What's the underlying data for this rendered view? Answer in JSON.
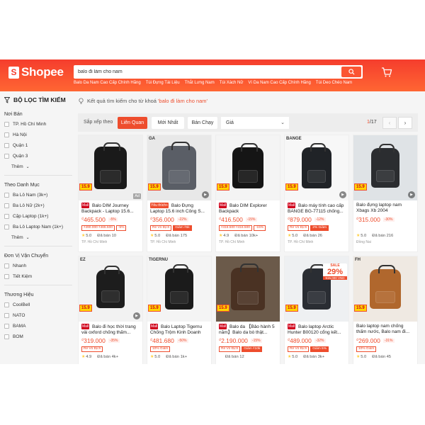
{
  "header": {
    "logo_text": "Shopee",
    "search_value": "balo đi làm cho nam",
    "keywords": [
      "Balo Da Nam Cao Cấp Chính Hãng",
      "Túi Đựng Tài Liệu",
      "Thắt Lưng Nam",
      "Túi Xách Nữ",
      "Ví Da Nam Cao Cấp Chính Hãng",
      "Túi Deo Chéo Nam"
    ]
  },
  "sidebar": {
    "title": "BỘ LỌC TÌM KIẾM",
    "groups": [
      {
        "title": "Nơi Bán",
        "options": [
          "TP. Hồ Chí Minh",
          "Hà Nội",
          "Quận 1",
          "Quận 3"
        ],
        "more": "Thêm"
      },
      {
        "title": "Theo Danh Mục",
        "options": [
          "Ba Lô Nam (3k+)",
          "Ba Lô Nữ (2k+)",
          "Cặp Laptop (1k+)",
          "Ba Lô Laptop Nam (1k+)"
        ],
        "more": "Thêm"
      },
      {
        "title": "Đơn Vị Vận Chuyển",
        "options": [
          "Nhanh",
          "Tiết Kiệm"
        ]
      },
      {
        "title": "Thương Hiệu",
        "options": [
          "CoolBell",
          "NATO",
          "BAMA",
          "BOM"
        ]
      }
    ]
  },
  "result": {
    "prefix": "Kết quả tìm kiếm cho từ khoá",
    "keyword": "'balo đi làm cho nam'"
  },
  "sortbar": {
    "label": "Sắp xếp theo",
    "options": [
      "Liên Quan",
      "Mới Nhất",
      "Bán Chạy"
    ],
    "price_label": "Giá",
    "page_current": "1",
    "page_total": "/17"
  },
  "products": [
    {
      "name": "Balo DIM Journey Backpack - Laptop 15.6...",
      "badge": "Mall",
      "price": "465.500",
      "disc": "-5%",
      "tags": [
        "₫490.000 ₫465.500",
        "-5%"
      ],
      "rating": "5.0",
      "sold": "Đã bán 10",
      "loc": "TP. Hồ Chí Minh",
      "bag": "#1a1a1a",
      "img": "#efefef",
      "ad": "Ad",
      "video": false,
      "top": ""
    },
    {
      "name": "Balo Đựng Laptop 15.6 inch Công S...",
      "badge": "Yêu thích+",
      "price": "356.000",
      "disc": "-22%",
      "tags": [
        "Rẻ Vô Địch",
        "Giảm ₫5k"
      ],
      "rating": "5.0",
      "sold": "Đã bán 175",
      "loc": "TP. Hồ Chí Minh",
      "bag": "#5a5e66",
      "img": "#e8e8e8",
      "ad": "",
      "video": true,
      "top": "GA"
    },
    {
      "name": "Balo DIM Explorer Backpack",
      "badge": "Mall",
      "price": "416.500",
      "disc": "-15%",
      "tags": [
        "₫416.500 ₫416.500",
        "-15%"
      ],
      "rating": "4.9",
      "sold": "Đã bán 10k+",
      "loc": "TP. Hồ Chí Minh",
      "bag": "#151515",
      "img": "#f4f4f4",
      "ad": "",
      "video": false,
      "top": ""
    },
    {
      "name": "Balo máy tính cao cấp BANGE BG-77115 chống...",
      "badge": "Mall",
      "price": "879.000",
      "disc": "-12%",
      "tags": [
        "Rẻ Vô Địch",
        "2% Giảm"
      ],
      "rating": "5.0",
      "sold": "Đã bán 26",
      "loc": "TP. Hồ Chí Minh",
      "bag": "#202327",
      "img": "#f7f7f7",
      "ad": "",
      "video": true,
      "top": "BANGE"
    },
    {
      "name": "Balo đựng laptop nam Xbags Xb 2004",
      "badge": "",
      "price": "315.000",
      "disc": "-30%",
      "tags": [],
      "rating": "5.0",
      "sold": "Đã bán 216",
      "loc": "Đồng Nai",
      "bag": "#2b2d30",
      "img": "#dfe3e6",
      "ad": "",
      "video": true,
      "top": ""
    },
    {
      "name": "Balo đi học thời trang vải oxford chống thấm...",
      "badge": "Mall",
      "price": "319.000",
      "disc": "-35%",
      "tags": [
        "Rẻ Vô Địch"
      ],
      "rating": "4.9",
      "sold": "Đã bán 4k+",
      "loc": "",
      "bag": "#1d1d1d",
      "img": "#f2f2f2",
      "ad": "",
      "video": true,
      "top": "EZ"
    },
    {
      "name": "Balo Laptop Tigernu Chống Trộm Kinh Doanh 15.6-1...",
      "badge": "Mall",
      "price": "481.680",
      "disc": "-50%",
      "tags": [
        "10% Giảm"
      ],
      "rating": "5.0",
      "sold": "Đã bán 1k+",
      "loc": "",
      "bag": "#1b1b1b",
      "img": "#f4f4f4",
      "ad": "",
      "video": false,
      "top": "TIGERNU"
    },
    {
      "name": "Balo da 【Bảo hành 5 năm】Balo da bò thật...",
      "badge": "Mall",
      "price": "2.190.000",
      "disc": "-15%",
      "tags": [
        "Rẻ Vô Địch",
        "Giảm ₫10k"
      ],
      "rating": "",
      "sold": "Đã bán 12",
      "loc": "",
      "bag": "#4a3223",
      "img": "#6b5a4a",
      "ad": "",
      "video": false,
      "top": ""
    },
    {
      "name": "Balo laptop Arctic Hunter B00120 cổng kết...",
      "badge": "Mall",
      "price": "489.000",
      "disc": "-32%",
      "tags": [
        "Rẻ Vô Địch",
        "Giảm 5%"
      ],
      "rating": "5.0",
      "sold": "Đã bán 3k+",
      "loc": "",
      "bag": "#2a2d33",
      "img": "#eef0f2",
      "ad": "",
      "video": false,
      "top": "",
      "sale": {
        "a": "SALE",
        "b": "29%",
        "c": "515.000 VND"
      }
    },
    {
      "name": "Balo laptop nam chống thấm nước, Balo nam đi...",
      "badge": "",
      "price": "269.000",
      "disc": "-31%",
      "tags": [
        "10% Giảm"
      ],
      "rating": "5.0",
      "sold": "Đã bán 45",
      "loc": "",
      "bag": "#b0672d",
      "img": "#efe9e2",
      "ad": "",
      "video": false,
      "top": "FH"
    }
  ]
}
